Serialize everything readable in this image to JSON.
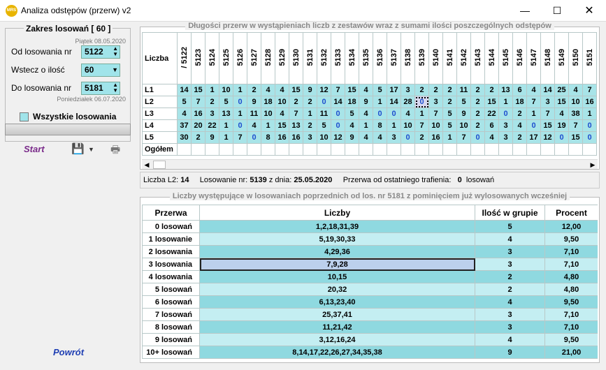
{
  "window": {
    "title": "Analiza odstępów (przerw) v2",
    "icon_text": "MRS"
  },
  "left": {
    "group_title": "Zakres losowań  [ 60 ]",
    "date_top": "Piątek 08.05.2020",
    "from_label": "Od losowania nr",
    "from_value": "5122",
    "back_label": "Wstecz o ilość",
    "back_value": "60",
    "to_label": "Do losowania nr",
    "to_value": "5181",
    "date_bottom": "Poniedziałek 06.07.2020",
    "all_label": "Wszystkie losowania",
    "start_label": "Start",
    "return_label": "Powrót"
  },
  "top_panel": {
    "caption": "Długości przerw w wystąpieniach liczb z zestawów wraz z sumami ilości poszczególnych odstępów",
    "corner_label": "Liczba",
    "columns": [
      "/\n5122",
      "5123",
      "5124",
      "5125",
      "5126",
      "5127",
      "5128",
      "5129",
      "5130",
      "5131",
      "5132",
      "5133",
      "5134",
      "5135",
      "5136",
      "5137",
      "5138",
      "5139",
      "5140",
      "5141",
      "5142",
      "5143",
      "5144",
      "5145",
      "5146",
      "5147",
      "5148",
      "5149",
      "5150",
      "5151"
    ],
    "rows": [
      {
        "label": "L1",
        "cells": [
          "14",
          "15",
          "1",
          "10",
          "1",
          "2",
          "4",
          "4",
          "15",
          "9",
          "12",
          "7",
          "15",
          "4",
          "5",
          "17",
          "3",
          "2",
          "2",
          "2",
          "11",
          "2",
          "2",
          "13",
          "6",
          "4",
          "14",
          "25",
          "4",
          "7"
        ]
      },
      {
        "label": "L2",
        "cells": [
          "5",
          "7",
          "2",
          "5",
          "0",
          "9",
          "18",
          "10",
          "2",
          "2",
          "0",
          "14",
          "18",
          "9",
          "1",
          "14",
          "28",
          "0",
          "3",
          "2",
          "5",
          "2",
          "15",
          "1",
          "18",
          "7",
          "3",
          "15",
          "10",
          "16"
        ]
      },
      {
        "label": "L3",
        "cells": [
          "4",
          "16",
          "3",
          "13",
          "1",
          "11",
          "10",
          "4",
          "7",
          "1",
          "11",
          "0",
          "5",
          "4",
          "0",
          "0",
          "4",
          "1",
          "7",
          "5",
          "9",
          "2",
          "22",
          "0",
          "2",
          "1",
          "7",
          "4",
          "38",
          "1"
        ]
      },
      {
        "label": "L4",
        "cells": [
          "37",
          "20",
          "22",
          "1",
          "0",
          "4",
          "1",
          "15",
          "13",
          "2",
          "5",
          "0",
          "4",
          "1",
          "8",
          "1",
          "10",
          "7",
          "10",
          "5",
          "10",
          "2",
          "6",
          "3",
          "4",
          "0",
          "15",
          "19",
          "7",
          "0"
        ]
      },
      {
        "label": "L5",
        "cells": [
          "30",
          "2",
          "9",
          "1",
          "7",
          "0",
          "8",
          "16",
          "16",
          "3",
          "10",
          "12",
          "9",
          "4",
          "4",
          "3",
          "0",
          "2",
          "16",
          "1",
          "7",
          "0",
          "4",
          "3",
          "2",
          "17",
          "12",
          "0",
          "15",
          "0"
        ]
      }
    ],
    "total_label": "Ogółem"
  },
  "status": {
    "l2_label": "Liczba L2:",
    "l2_value": "14",
    "draw_label": "Losowanie nr:",
    "draw_value": "5139",
    "date_label": "z dnia:",
    "date_value": "25.05.2020",
    "gap_label": "Przerwa od ostatniego trafienia:",
    "gap_value": "0",
    "gap_unit": "losowań"
  },
  "bottom_panel": {
    "caption": "Liczby występujące w losowaniach poprzednich od los. nr 5181 z pominięciem już wylosowanych wcześniej",
    "headers": [
      "Przerwa",
      "Liczby",
      "Ilość w grupie",
      "Procent"
    ],
    "rows": [
      [
        "0 losowań",
        "1,2,18,31,39",
        "5",
        "12,00"
      ],
      [
        "1 losowanie",
        "5,19,30,33",
        "4",
        "9,50"
      ],
      [
        "2 losowania",
        "4,29,36",
        "3",
        "7,10"
      ],
      [
        "3 losowania",
        "7,9,28",
        "3",
        "7,10"
      ],
      [
        "4 losowania",
        "10,15",
        "2",
        "4,80"
      ],
      [
        "5 losowań",
        "20,32",
        "2",
        "4,80"
      ],
      [
        "6 losowań",
        "6,13,23,40",
        "4",
        "9,50"
      ],
      [
        "7 losowań",
        "25,37,41",
        "3",
        "7,10"
      ],
      [
        "8 losowań",
        "11,21,42",
        "3",
        "7,10"
      ],
      [
        "9 losowań",
        "3,12,16,24",
        "4",
        "9,50"
      ],
      [
        "10+ losowań",
        "8,14,17,22,26,27,34,35,38",
        "9",
        "21,00"
      ]
    ]
  }
}
